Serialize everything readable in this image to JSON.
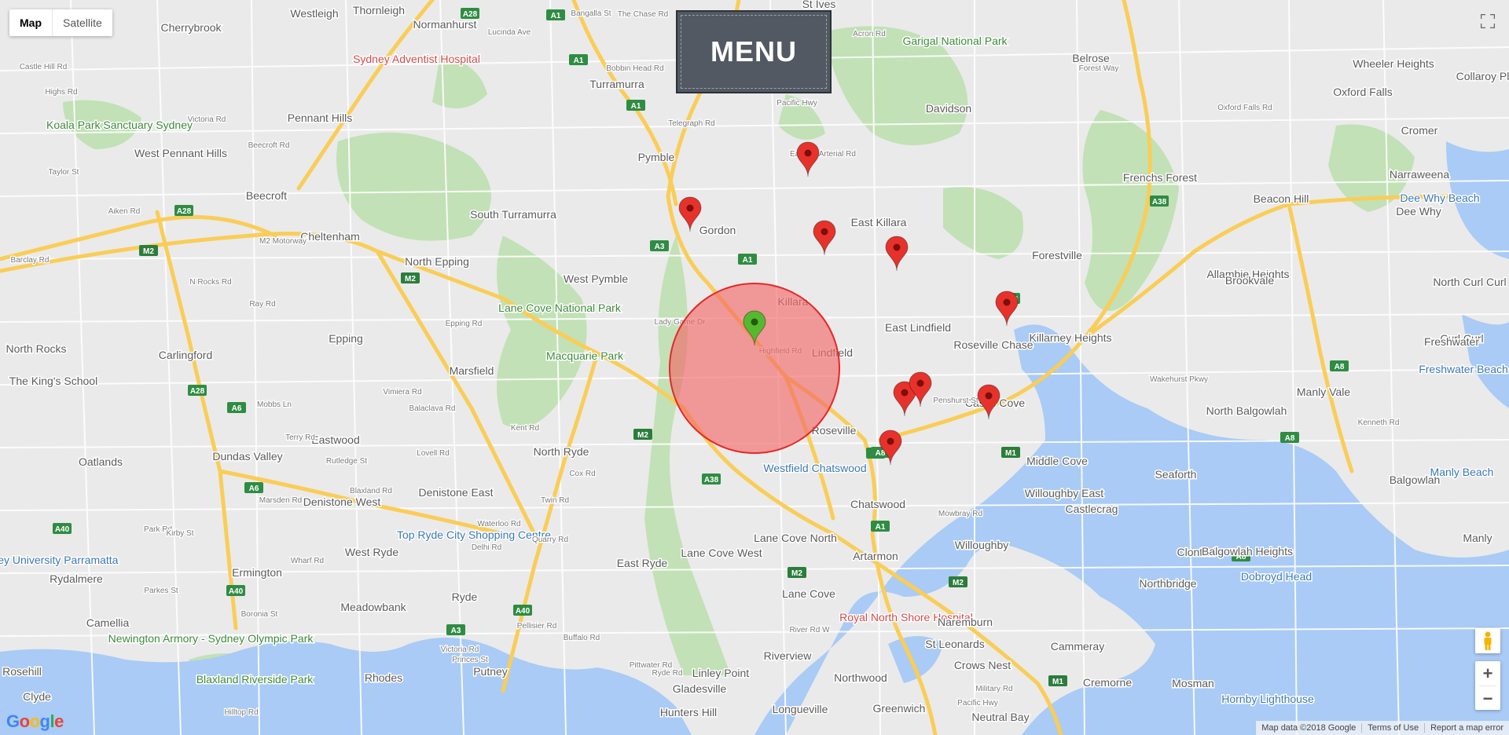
{
  "map": {
    "map_type_control": {
      "map_label": "Map",
      "satellite_label": "Satellite",
      "selected": "Map"
    },
    "menu_label": "MENU",
    "highway_shields": [
      "A28",
      "A1",
      "A1",
      "A1",
      "A3",
      "A1",
      "M2",
      "A28",
      "M2",
      "M2",
      "A28",
      "A6",
      "A6",
      "A38",
      "A40",
      "A40",
      "A40",
      "A3",
      "M2",
      "A1",
      "A1",
      "M2",
      "M1",
      "M1",
      "A38",
      "A38",
      "A8",
      "A8",
      "A8",
      "A8"
    ],
    "place_labels": [
      "Westleigh",
      "Thornleigh",
      "St Ives",
      "Cherrybrook",
      "Normanhurst",
      "Sydney Adventist Hospital",
      "Garigal National Park",
      "Belrose",
      "Wheeler Heights",
      "Collaroy Plateau",
      "Oxford Falls",
      "Davidson",
      "Turramurra",
      "Koala Park Sanctuary Sydney",
      "Pennant Hills",
      "West Pennant Hills",
      "Cromer",
      "Narraweena",
      "Pymble",
      "Frenchs Forest",
      "Beacon Hill",
      "Dee Why Beach",
      "Dee Why",
      "Beecroft",
      "South Turramurra",
      "Gordon",
      "East Killara",
      "Cheltenham",
      "North Epping",
      "Forestville",
      "Allambie Heights",
      "Brookvale",
      "North Curl Curl",
      "West Pymble",
      "Lane Cove National Park",
      "Killara",
      "East Lindfield",
      "Roseville Chase",
      "Killarney Heights",
      "Curl Curl",
      "Freshwater",
      "Epping",
      "North Rocks",
      "Carlingford",
      "Macquarie Park",
      "Marsfield",
      "Lindfield",
      "Freshwater Beach",
      "Manly Vale",
      "The King's School",
      "Castle Cove",
      "North Balgowlah",
      "Roseville",
      "Eastwood",
      "North Ryde",
      "Oatlands",
      "Dundas Valley",
      "Westfield Chatswood",
      "Middle Cove",
      "Balgowlah",
      "Seaforth",
      "Manly Beach",
      "Denistone East",
      "Denistone West",
      "Chatswood",
      "Willoughby East",
      "Castlecrag",
      "Top Ryde City Shopping Centre",
      "Western Sydney University Parramatta",
      "West Ryde",
      "Lane Cove North",
      "Willoughby",
      "Manly",
      "Rydalmere",
      "Ermington",
      "East Ryde",
      "Lane Cove West",
      "Artarmon",
      "Clontarf",
      "Balgowlah Heights",
      "Northbridge",
      "Dobroyd Head",
      "Meadowbank",
      "Ryde",
      "Lane Cove",
      "Royal North Shore Hospital",
      "Naremburn",
      "Camellia",
      "Newington Armory - Sydney Olympic Park",
      "St Leonards",
      "Cammeray",
      "Riverview",
      "Crows Nest",
      "Putney",
      "Blaxland Riverside Park",
      "Rhodes",
      "Linley Point",
      "Northwood",
      "Cremorne",
      "Mosman",
      "Rosehill",
      "Gladesville",
      "Hornby Lighthouse",
      "Clyde",
      "Hunters Hill",
      "Longueville",
      "Greenwich",
      "Neutral Bay"
    ],
    "street_labels": [
      "Castle Hill Rd",
      "Highs Rd",
      "Bangalla St",
      "The Chase Rd",
      "Lucinda Ave",
      "Acron Rd",
      "Forest Way",
      "Oxford Falls Rd",
      "Pacific Hwy",
      "Eastern Arterial Rd",
      "Telegraph Rd",
      "Bobbin Head Rd",
      "Victoria Rd",
      "Taylor St",
      "Beecroft Rd",
      "Aiken Rd",
      "M2 Motorway",
      "Barclay Rd",
      "N Rocks Rd",
      "Ray Rd",
      "Lady Game Dr",
      "Highfield Rd",
      "Epping Rd",
      "Vimiera Rd",
      "Balaclava Rd",
      "Mobbs Ln",
      "Terry Rd",
      "Lovell Rd",
      "Rutledge St",
      "Kent Rd",
      "Wakehurst Pkwy",
      "Kenneth Rd",
      "Penshurst St",
      "Mowbray Rd",
      "Boronia St",
      "Quarry Rd",
      "River Rd W",
      "Victoria Rd",
      "Pittwater Rd",
      "Ryde Rd",
      "Pellisier Rd",
      "Buffalo Rd",
      "Wharf Rd",
      "Parkes St",
      "Park Rd",
      "Kirby St",
      "Princes St",
      "Hilltop Rd",
      "Military Rd",
      "Marsden Rd",
      "Blaxland Rd",
      "Twin Rd",
      "Cox Rd",
      "Waterloo Rd",
      "Delhi Rd",
      "Pacific Hwy"
    ],
    "radius_circle": {
      "fill_color": "#f26a6a",
      "stroke_color": "#e52828",
      "radius_km": 2
    },
    "markers": [
      {
        "type": "center",
        "color": "#56b82e",
        "label": "Lady Game Dr"
      },
      {
        "type": "result",
        "color": "#e7322b"
      },
      {
        "type": "result",
        "color": "#e7322b"
      },
      {
        "type": "result",
        "color": "#e7322b"
      },
      {
        "type": "result",
        "color": "#e7322b"
      },
      {
        "type": "result",
        "color": "#e7322b"
      },
      {
        "type": "result",
        "color": "#e7322b"
      },
      {
        "type": "result",
        "color": "#e7322b"
      },
      {
        "type": "result",
        "color": "#e7322b"
      },
      {
        "type": "result",
        "color": "#e7322b"
      }
    ],
    "zoom": {
      "in_label": "+",
      "out_label": "−"
    },
    "logo_text": "Google",
    "attribution": {
      "map_data": "Map data ©2018 Google",
      "terms": "Terms of Use",
      "report": "Report a map error"
    },
    "colors": {
      "land": "#eaeaea",
      "park": "#bfe0b4",
      "water": "#a9cbf5",
      "major_road": "#f9cd57",
      "minor_road": "#ffffff",
      "label": "#5b5b5b"
    }
  }
}
